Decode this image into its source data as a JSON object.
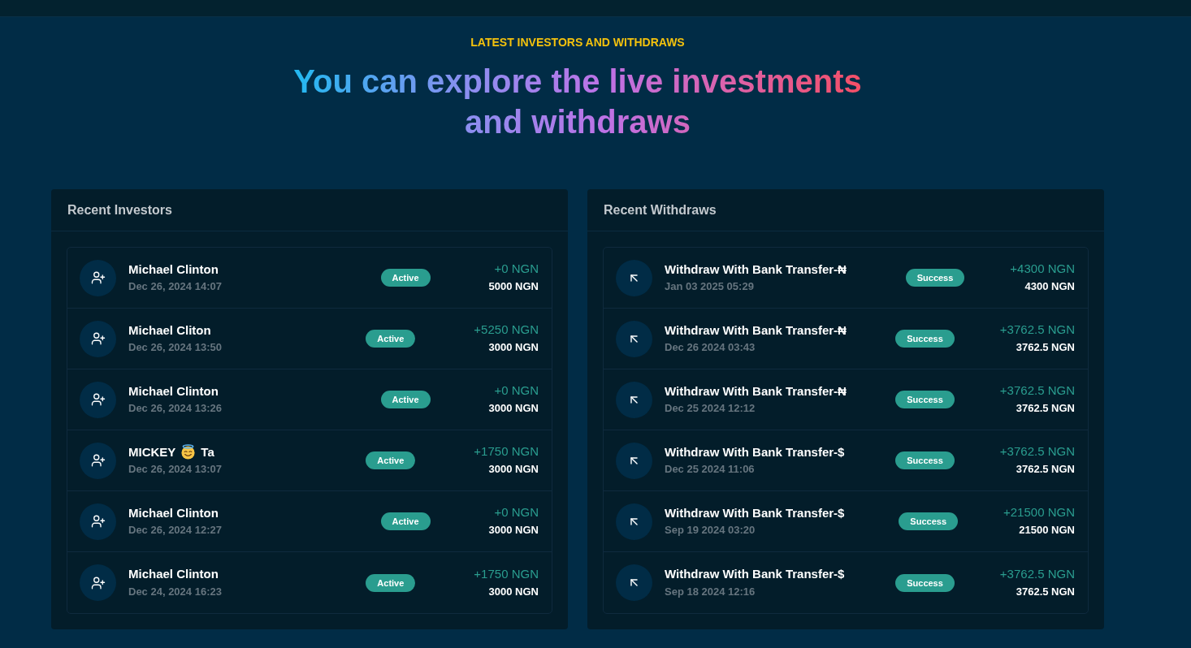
{
  "section": {
    "eyebrow": "LATEST INVESTORS AND WITHDRAWS",
    "title_lines": [
      "You can explore the live investments",
      "and withdraws"
    ]
  },
  "panels": [
    {
      "title": "Recent Investors",
      "kind": "investors",
      "items": [
        {
          "name": "Michael Clinton",
          "emoji": false,
          "date": "Dec 26, 2024 14:07",
          "status": "Active",
          "profit": "+0 NGN",
          "amount": "5000 NGN"
        },
        {
          "name": "Michael Cliton",
          "emoji": false,
          "date": "Dec 26, 2024 13:50",
          "status": "Active",
          "profit": "+5250 NGN",
          "amount": "3000 NGN"
        },
        {
          "name": "Michael Clinton",
          "emoji": false,
          "date": "Dec 26, 2024 13:26",
          "status": "Active",
          "profit": "+0 NGN",
          "amount": "3000 NGN"
        },
        {
          "name": "MICKEY",
          "emoji": true,
          "name_after": "Ta",
          "date": "Dec 26, 2024 13:07",
          "status": "Active",
          "profit": "+1750 NGN",
          "amount": "3000 NGN"
        },
        {
          "name": "Michael Clinton",
          "emoji": false,
          "date": "Dec 26, 2024 12:27",
          "status": "Active",
          "profit": "+0 NGN",
          "amount": "3000 NGN"
        },
        {
          "name": "Michael Clinton",
          "emoji": false,
          "date": "Dec 24, 2024 16:23",
          "status": "Active",
          "profit": "+1750 NGN",
          "amount": "3000 NGN"
        }
      ]
    },
    {
      "title": "Recent Withdraws",
      "kind": "withdraws",
      "items": [
        {
          "name": "Withdraw With Bank Transfer-₦",
          "emoji": false,
          "date": "Jan 03 2025 05:29",
          "status": "Success",
          "profit": "+4300 NGN",
          "amount": "4300 NGN"
        },
        {
          "name": "Withdraw With Bank Transfer-₦",
          "emoji": false,
          "date": "Dec 26 2024 03:43",
          "status": "Success",
          "profit": "+3762.5 NGN",
          "amount": "3762.5 NGN"
        },
        {
          "name": "Withdraw With Bank Transfer-₦",
          "emoji": false,
          "date": "Dec 25 2024 12:12",
          "status": "Success",
          "profit": "+3762.5 NGN",
          "amount": "3762.5 NGN"
        },
        {
          "name": "Withdraw With Bank Transfer-$",
          "emoji": false,
          "date": "Dec 25 2024 11:06",
          "status": "Success",
          "profit": "+3762.5 NGN",
          "amount": "3762.5 NGN"
        },
        {
          "name": "Withdraw With Bank Transfer-$",
          "emoji": false,
          "date": "Sep 19 2024 03:20",
          "status": "Success",
          "profit": "+21500 NGN",
          "amount": "21500 NGN"
        },
        {
          "name": "Withdraw With Bank Transfer-$",
          "emoji": false,
          "date": "Sep 18 2024 12:16",
          "status": "Success",
          "profit": "+3762.5 NGN",
          "amount": "3762.5 NGN"
        }
      ]
    }
  ]
}
